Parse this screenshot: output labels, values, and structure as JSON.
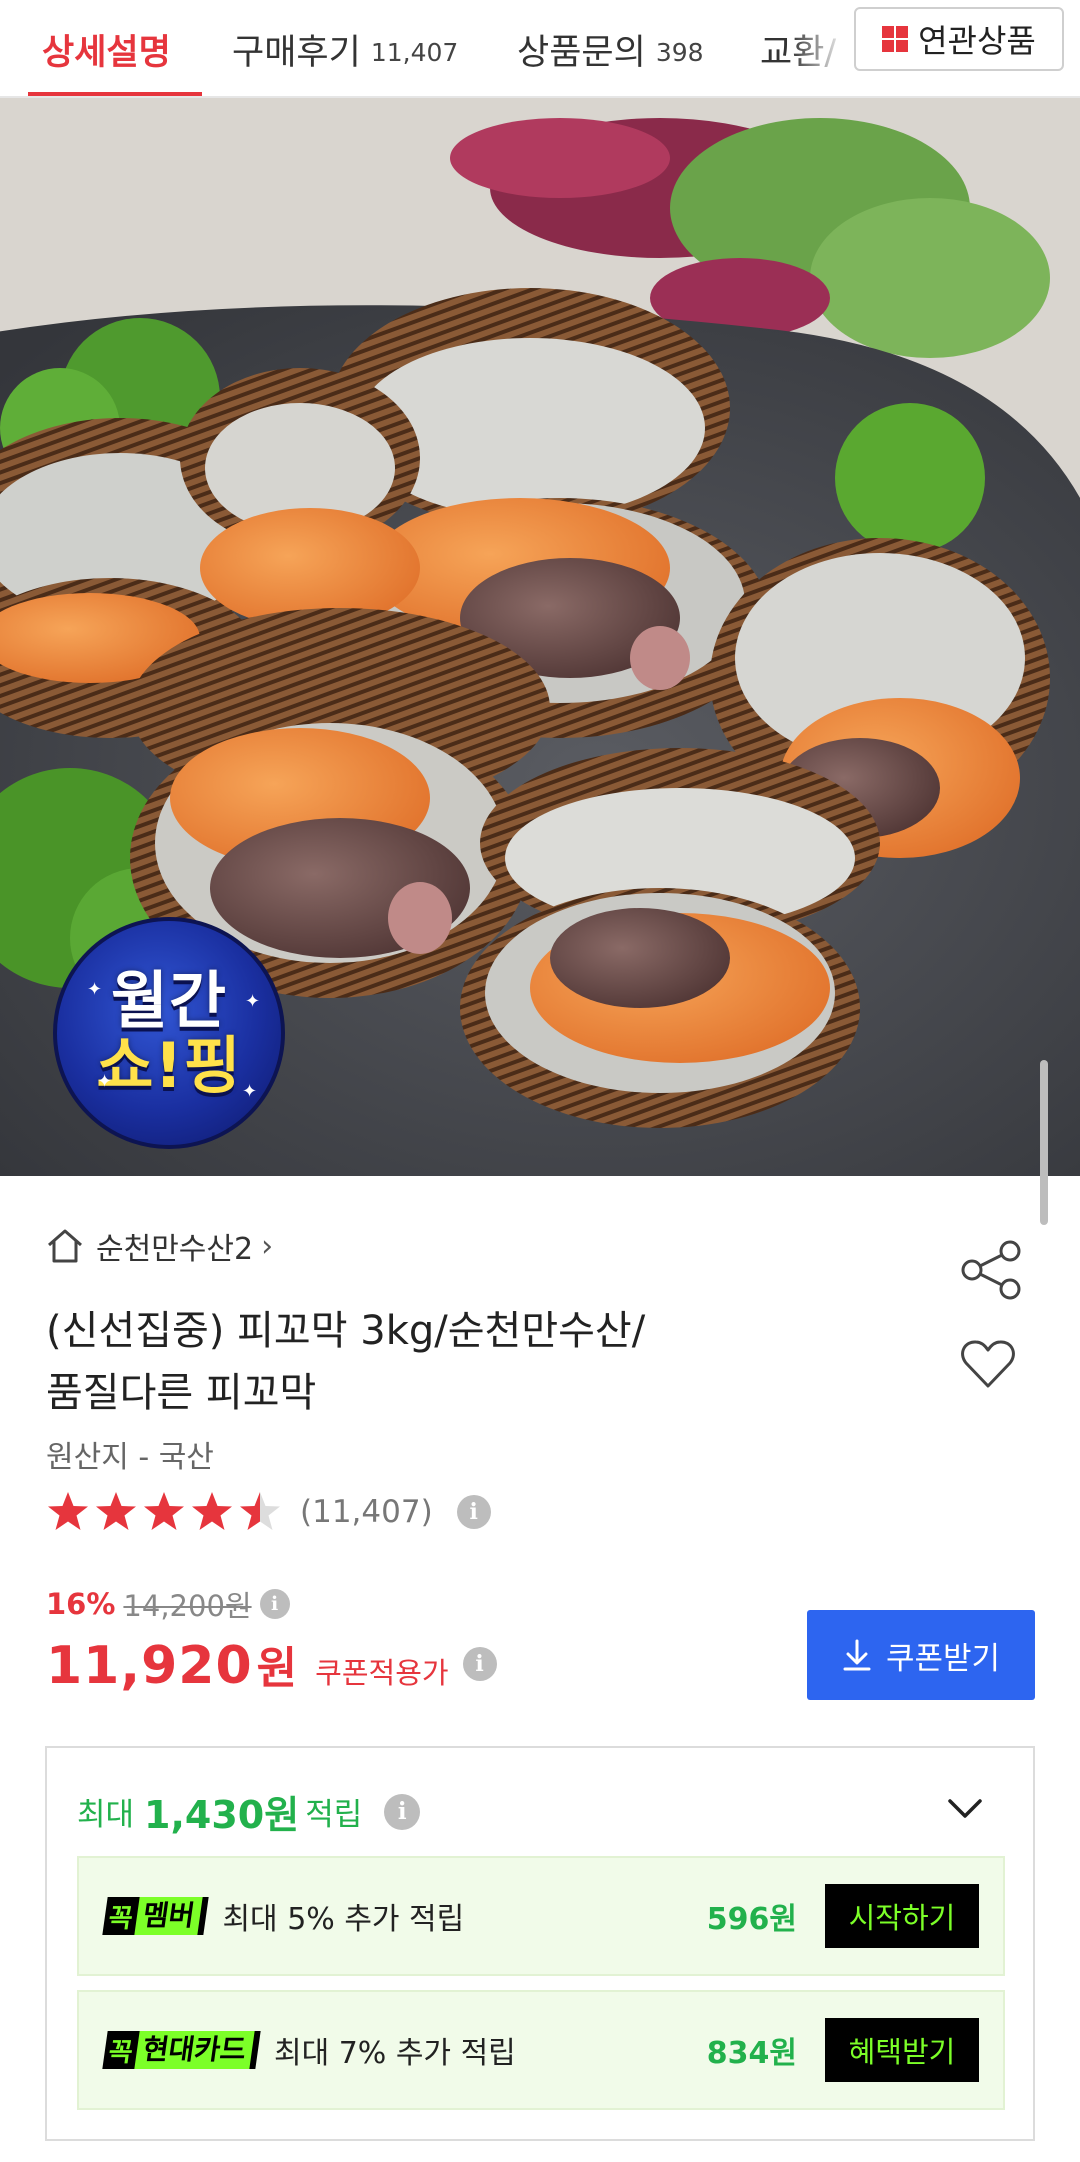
{
  "tabs": [
    {
      "label": "상세설명",
      "count": "",
      "active": true
    },
    {
      "label": "구매후기",
      "count": "11,407",
      "active": false
    },
    {
      "label": "상품문의",
      "count": "398",
      "active": false
    },
    {
      "label": "교환/",
      "count": "",
      "active": false
    }
  ],
  "related": {
    "label": "연관상품",
    "icon": "grid-icon"
  },
  "badge": {
    "line1": "월간",
    "line2": "쇼!핑"
  },
  "store": {
    "name": "순천만수산2",
    "icon": "home-icon"
  },
  "product": {
    "title_line1": "(신선집중) 피꼬막 3kg/순천만수산/",
    "title_line2": "품질다른 피꼬막",
    "origin": "원산지 - 국산",
    "rating_value": 4.5,
    "review_count": "(11,407)"
  },
  "price": {
    "discount": "16%",
    "original": "14,200원",
    "final": "11,920",
    "unit": "원",
    "coupon_note": "쿠폰적용가",
    "coupon_button": "쿠폰받기",
    "accent": "#e6353d",
    "button_color": "#2d65f0"
  },
  "points": {
    "prefix": "최대",
    "amount": "1,430원",
    "suffix": "적립",
    "accent": "#22b14c",
    "benefits": [
      {
        "badge_mark": "꼭",
        "badge_label": "멤버",
        "description": "최대 5% 추가 적립",
        "amount": "596원",
        "action": "시작하기"
      },
      {
        "badge_mark": "꼭",
        "badge_label": "현대카드",
        "description": "최대 7% 추가 적립",
        "amount": "834원",
        "action": "혜택받기"
      }
    ]
  }
}
